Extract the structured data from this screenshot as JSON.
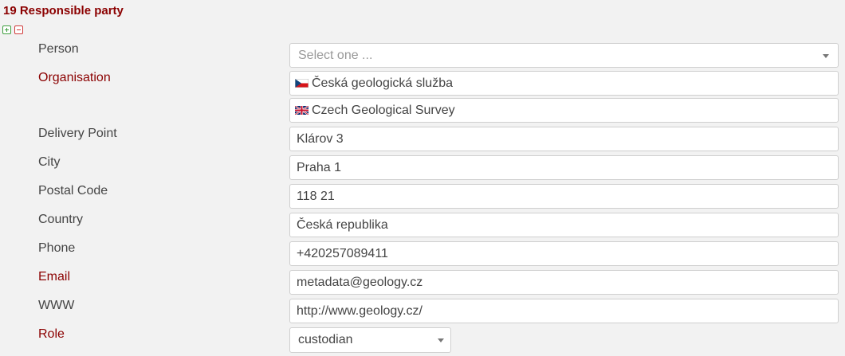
{
  "section": {
    "title": "19 Responsible party"
  },
  "controls": {
    "add_icon": "plus-box-icon",
    "remove_icon": "minus-box-icon"
  },
  "fields": {
    "person": {
      "label": "Person",
      "placeholder": "Select one ..."
    },
    "organisation": {
      "label": "Organisation",
      "values": [
        {
          "lang_icon": "czech-flag-icon",
          "value": "Česká geologická služba"
        },
        {
          "lang_icon": "uk-flag-icon",
          "value": "Czech Geological Survey"
        }
      ]
    },
    "delivery_point": {
      "label": "Delivery Point",
      "value": "Klárov 3"
    },
    "city": {
      "label": "City",
      "value": "Praha 1"
    },
    "postal_code": {
      "label": "Postal Code",
      "value": "118 21"
    },
    "country": {
      "label": "Country",
      "value": "Česká republika"
    },
    "phone": {
      "label": "Phone",
      "value": "+420257089411"
    },
    "email": {
      "label": "Email",
      "value": "metadata@geology.cz"
    },
    "www": {
      "label": "WWW",
      "value": "http://www.geology.cz/"
    },
    "role": {
      "label": "Role",
      "value": "custodian"
    }
  },
  "colors": {
    "required_label": "#8b0000",
    "label": "#444444",
    "background": "#f2f2f2",
    "add_icon": "#3f9f3f",
    "remove_icon": "#d03a3a"
  }
}
